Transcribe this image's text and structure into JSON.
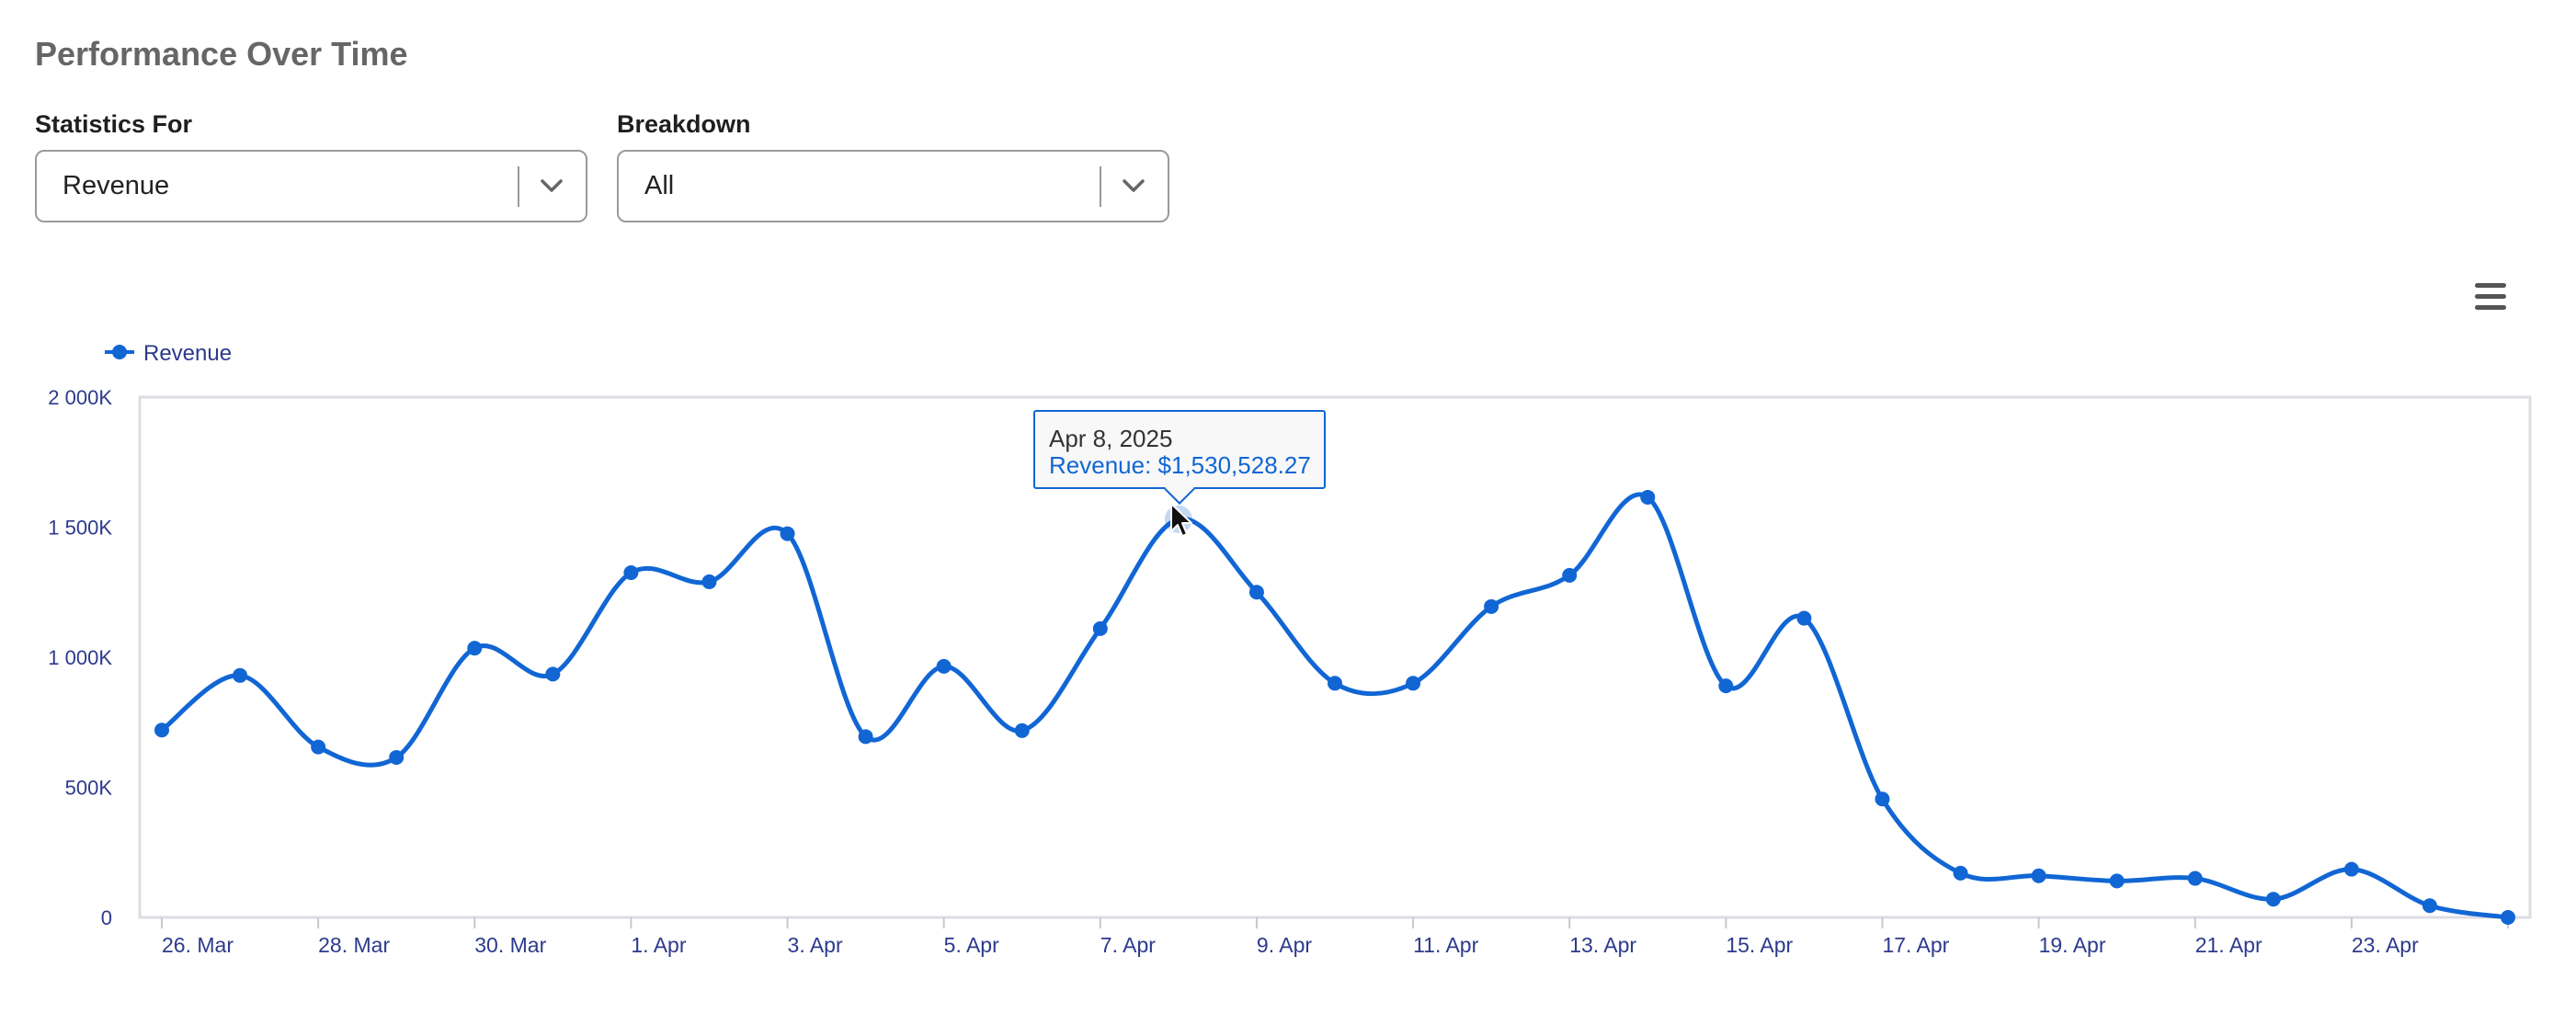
{
  "header": {
    "title": "Performance Over Time"
  },
  "filters": {
    "statistics_label": "Statistics For",
    "statistics_value": "Revenue",
    "breakdown_label": "Breakdown",
    "breakdown_value": "All"
  },
  "tooltip": {
    "date": "Apr 8, 2025",
    "text": "Revenue: $1,530,528.27"
  },
  "icons": {
    "menu": "hamburger-menu-icon",
    "chevron": "chevron-down-icon",
    "cursor": "mouse-pointer-icon"
  },
  "colors": {
    "series": "#1166d4",
    "axis_text": "#2c3a8c",
    "title": "#666666"
  },
  "chart_data": {
    "type": "line",
    "categories": [
      "26. Mar",
      "27. Mar",
      "28. Mar",
      "29. Mar",
      "30. Mar",
      "31. Mar",
      "1. Apr",
      "2. Apr",
      "3. Apr",
      "4. Apr",
      "5. Apr",
      "6. Apr",
      "7. Apr",
      "8. Apr",
      "9. Apr",
      "10. Apr",
      "11. Apr",
      "12. Apr",
      "13. Apr",
      "14. Apr",
      "15. Apr",
      "16. Apr",
      "17. Apr",
      "18. Apr",
      "19. Apr",
      "20. Apr",
      "21. Apr",
      "22. Apr",
      "23. Apr",
      "24. Apr",
      "25. Apr"
    ],
    "tick_labels": [
      "26. Mar",
      "28. Mar",
      "30. Mar",
      "1. Apr",
      "3. Apr",
      "5. Apr",
      "7. Apr",
      "9. Apr",
      "11. Apr",
      "13. Apr",
      "15. Apr",
      "17. Apr",
      "19. Apr",
      "21. Apr",
      "23. Apr"
    ],
    "series": [
      {
        "name": "Revenue",
        "values": [
          720000,
          930000,
          655000,
          615000,
          1035000,
          935000,
          1325000,
          1290000,
          1475000,
          695000,
          965000,
          718000,
          1110000,
          1530528.27,
          1250000,
          900000,
          900000,
          1195000,
          1315000,
          1615000,
          890000,
          1150000,
          455000,
          170000,
          160000,
          140000,
          150000,
          70000,
          185000,
          45000,
          0
        ]
      }
    ],
    "y_ticks": [
      0,
      500000,
      1000000,
      1500000,
      2000000
    ],
    "y_tick_labels": [
      "0",
      "500K",
      "1 000K",
      "1 500K",
      "2 000K"
    ],
    "ylim": [
      0,
      2000000
    ],
    "legend": "top-left",
    "grid": false,
    "highlight_index": 13
  }
}
